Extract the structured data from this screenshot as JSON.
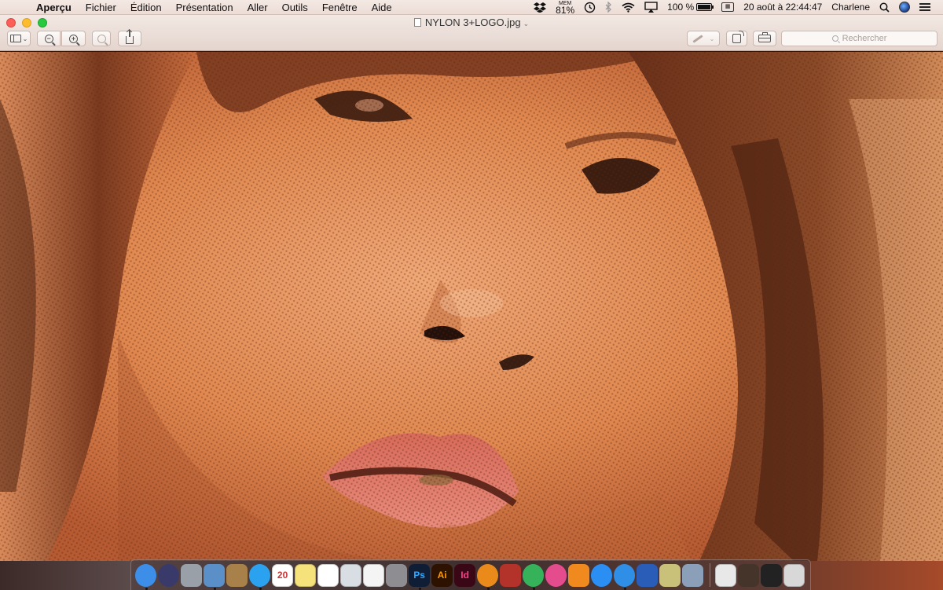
{
  "menubar": {
    "apple_glyph": "",
    "app_name": "Aperçu",
    "menus": [
      "Fichier",
      "Édition",
      "Présentation",
      "Aller",
      "Outils",
      "Fenêtre",
      "Aide"
    ],
    "mem_label": "MEM",
    "mem_value": "81%",
    "battery_percent": "100 %",
    "battery_level": 1.0,
    "datetime": "20 août à  22:44:47",
    "user": "Charlene"
  },
  "window": {
    "title": "NYLON 3+LOGO.jpg",
    "search_placeholder": "Rechercher",
    "toolbar": {
      "zoom_out_glyph": "−",
      "zoom_in_glyph": "+",
      "zoom_fit_glyph": ""
    }
  },
  "photo": {
    "description_icon": "halftone-portrait-image",
    "palette": [
      "#e2864e",
      "#c4623a",
      "#7a3a22",
      "#3a1c12",
      "#f3a070",
      "#d9776e"
    ]
  },
  "dock": {
    "items": [
      {
        "name": "finder",
        "label": "",
        "color": "#3d8ee8"
      },
      {
        "name": "siri",
        "label": "",
        "color": "#3a3a6a"
      },
      {
        "name": "launchpad",
        "label": "",
        "color": "#9aa0a8"
      },
      {
        "name": "preview",
        "label": "",
        "color": "#5a8fc8"
      },
      {
        "name": "contacts",
        "label": "",
        "color": "#a8804a"
      },
      {
        "name": "messages",
        "label": "",
        "color": "#2aa2f0"
      },
      {
        "name": "calendar",
        "label": "20",
        "color": "#ffffff"
      },
      {
        "name": "notes",
        "label": "",
        "color": "#f6e27a"
      },
      {
        "name": "reminders",
        "label": "",
        "color": "#ffffff"
      },
      {
        "name": "photo-booth",
        "label": "",
        "color": "#d9dde4"
      },
      {
        "name": "photos",
        "label": "",
        "color": "#f4f4f4"
      },
      {
        "name": "system-preferences",
        "label": "",
        "color": "#8d8d92"
      },
      {
        "name": "photoshop",
        "label": "Ps",
        "color": "#0f1e35"
      },
      {
        "name": "illustrator",
        "label": "Ai",
        "color": "#2d1200"
      },
      {
        "name": "indesign",
        "label": "Id",
        "color": "#3a0716"
      },
      {
        "name": "vlc",
        "label": "",
        "color": "#e98a1a"
      },
      {
        "name": "photo-app",
        "label": "",
        "color": "#b3322a"
      },
      {
        "name": "facetime",
        "label": "",
        "color": "#36b35a"
      },
      {
        "name": "itunes",
        "label": "",
        "color": "#e54c8e"
      },
      {
        "name": "ibooks",
        "label": "",
        "color": "#f08a1e"
      },
      {
        "name": "app-store",
        "label": "",
        "color": "#2b8ef3"
      },
      {
        "name": "safari",
        "label": "",
        "color": "#2f8fe6"
      },
      {
        "name": "teamviewer",
        "label": "",
        "color": "#2a5db8"
      },
      {
        "name": "archive-utility",
        "label": "",
        "color": "#c9c07a"
      },
      {
        "name": "image-capture",
        "label": "",
        "color": "#8b9fb8"
      }
    ],
    "recent": [
      {
        "name": "excel-file",
        "label": "",
        "color": "#e8e8e8"
      },
      {
        "name": "photoshop-file",
        "label": "",
        "color": "#44342a"
      },
      {
        "name": "screen-recording",
        "label": "",
        "color": "#222222"
      },
      {
        "name": "trash",
        "label": "",
        "color": "#d8d8d8"
      }
    ]
  }
}
